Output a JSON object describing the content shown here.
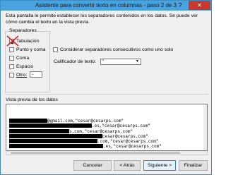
{
  "window": {
    "title": "Asistente para convertir texto en columnas - paso 2 de 3",
    "help": "?",
    "close": "✕"
  },
  "description": "Esta pantalla le permite establecer los separadores contenidos en los datos. Se puede ver cómo cambia el texto en la vista previa.",
  "separators": {
    "legend": "Separadores",
    "items": [
      {
        "label": "Tabulación",
        "checked": true
      },
      {
        "label": "Punto y coma",
        "checked": false
      },
      {
        "label": "Coma",
        "checked": false
      },
      {
        "label": "Espacio",
        "checked": false
      },
      {
        "label": "Otro:",
        "checked": false
      }
    ],
    "other_value": "-"
  },
  "consecutive": {
    "label": "Considerar separadores consecutivos como uno solo",
    "checked": false
  },
  "qualifier": {
    "label": "Calificador de texto:",
    "value": "\""
  },
  "preview": {
    "label": "Vista previa de los datos",
    "rows": [
      "@gmail.com,\"cesar@cesarps.com\"",
      ".es,\"cesar@cesarps.com\"",
      "s.com,\"cesar@cesarps.com\"",
      "cesar@cesarps.com\"",
      ".com,\"cesar@cesarps.com\"",
      ".es,\"cesar@cesarps.com\""
    ]
  },
  "buttons": {
    "cancel": "Cancelar",
    "back": "< Atrás",
    "next": "Siguiente >",
    "finish": "Finalizar"
  }
}
